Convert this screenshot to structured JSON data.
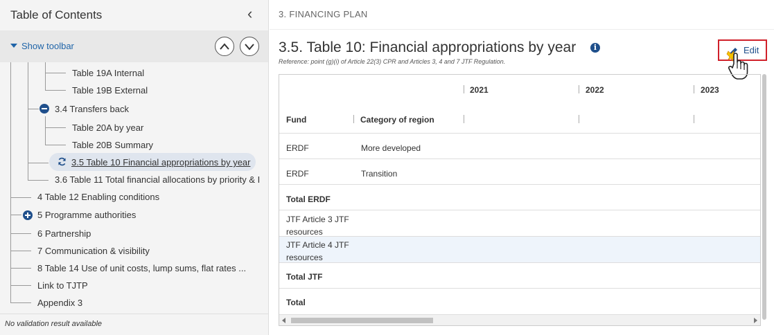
{
  "sidebar": {
    "title": "Table of Contents",
    "toolbar_label": "Show toolbar",
    "tree": {
      "t19a": "Table 19A Internal",
      "t19b": "Table 19B External",
      "n34": "3.4 Transfers back",
      "t20a": "Table 20A by year",
      "t20b": "Table 20B Summary",
      "n35": "3.5 Table 10 Financial appropriations by year",
      "n36": "3.6 Table 11 Total financial allocations by priority & I",
      "n4": "4 Table 12 Enabling conditions",
      "n5": "5 Programme authorities",
      "n6": "6 Partnership",
      "n7": "7 Communication & visibility",
      "n8": "8 Table 14 Use of unit costs, lump sums, flat rates ...",
      "link": "Link to TJTP",
      "app3": "Appendix 3"
    },
    "validation": "No validation result available"
  },
  "main": {
    "section": "3. FINANCING PLAN",
    "title": "3.5. Table 10: Financial appropriations by year",
    "reference": "Reference: point (g)(i) of Article 22(3) CPR and Articles 3, 4 and 7 JTF Regulation.",
    "edit_label": "Edit"
  },
  "table": {
    "years": [
      "2021",
      "2022",
      "2023"
    ],
    "col_fund": "Fund",
    "col_region": "Category of region",
    "rows": [
      {
        "fund": "ERDF",
        "region": "More developed"
      },
      {
        "fund": "ERDF",
        "region": "Transition"
      },
      {
        "fund": "Total ERDF",
        "region": ""
      },
      {
        "fund": "JTF Article 3 JTF resources",
        "region": ""
      },
      {
        "fund": "JTF Article 4 JTF resources",
        "region": ""
      },
      {
        "fund": "Total JTF",
        "region": ""
      },
      {
        "fund": "Total",
        "region": ""
      }
    ]
  },
  "colors": {
    "accent": "#1f4f8b",
    "link": "#1f64a8",
    "edit_border": "#d0202a",
    "selected_node": "#dfe5ee",
    "highlight_row": "#eef4fb"
  }
}
